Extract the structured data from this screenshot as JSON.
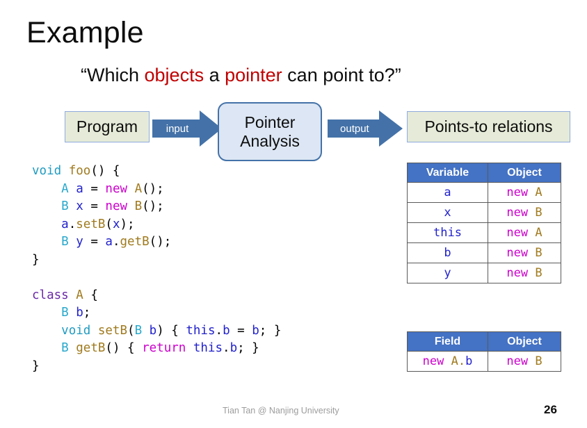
{
  "slide": {
    "title": "Example",
    "subtitle": {
      "part1": "“Which ",
      "hl1": "objects",
      "part2": " a ",
      "hl2": "pointer",
      "part3": " can point to?”"
    }
  },
  "diagram": {
    "program_label": "Program",
    "input_arrow_label": "input",
    "analysis_label_line1": "Pointer",
    "analysis_label_line2": "Analysis",
    "output_arrow_label": "output",
    "points_to_label": "Points-to relations",
    "arrow_color": "#4472A8",
    "box_fill": "#E5EBD8",
    "box_border": "#8FAADC",
    "analysis_fill": "#DCE6F4",
    "analysis_border": "#4472A8"
  },
  "code": {
    "lines": [
      [
        {
          "t": "void",
          "c": "t-kw"
        },
        {
          "t": " ",
          "c": "t-plain"
        },
        {
          "t": "foo",
          "c": "t-fn"
        },
        {
          "t": "() {",
          "c": "t-plain"
        }
      ],
      [
        {
          "t": "    ",
          "c": "t-plain"
        },
        {
          "t": "A",
          "c": "t-type"
        },
        {
          "t": " ",
          "c": "t-plain"
        },
        {
          "t": "a",
          "c": "t-var"
        },
        {
          "t": " = ",
          "c": "t-plain"
        },
        {
          "t": "new",
          "c": "t-new"
        },
        {
          "t": " ",
          "c": "t-plain"
        },
        {
          "t": "A",
          "c": "t-fn"
        },
        {
          "t": "();",
          "c": "t-plain"
        }
      ],
      [
        {
          "t": "    ",
          "c": "t-plain"
        },
        {
          "t": "B",
          "c": "t-type"
        },
        {
          "t": " ",
          "c": "t-plain"
        },
        {
          "t": "x",
          "c": "t-var"
        },
        {
          "t": " = ",
          "c": "t-plain"
        },
        {
          "t": "new",
          "c": "t-new"
        },
        {
          "t": " ",
          "c": "t-plain"
        },
        {
          "t": "B",
          "c": "t-fn"
        },
        {
          "t": "();",
          "c": "t-plain"
        }
      ],
      [
        {
          "t": "    ",
          "c": "t-plain"
        },
        {
          "t": "a",
          "c": "t-var"
        },
        {
          "t": ".",
          "c": "t-plain"
        },
        {
          "t": "setB",
          "c": "t-fn"
        },
        {
          "t": "(",
          "c": "t-plain"
        },
        {
          "t": "x",
          "c": "t-var"
        },
        {
          "t": ");",
          "c": "t-plain"
        }
      ],
      [
        {
          "t": "    ",
          "c": "t-plain"
        },
        {
          "t": "B",
          "c": "t-type"
        },
        {
          "t": " ",
          "c": "t-plain"
        },
        {
          "t": "y",
          "c": "t-var"
        },
        {
          "t": " = ",
          "c": "t-plain"
        },
        {
          "t": "a",
          "c": "t-var"
        },
        {
          "t": ".",
          "c": "t-plain"
        },
        {
          "t": "getB",
          "c": "t-fn"
        },
        {
          "t": "();",
          "c": "t-plain"
        }
      ],
      [
        {
          "t": "}",
          "c": "t-plain"
        }
      ],
      [
        {
          "t": "",
          "c": "t-plain"
        }
      ],
      [
        {
          "t": "class",
          "c": "t-class"
        },
        {
          "t": " ",
          "c": "t-plain"
        },
        {
          "t": "A",
          "c": "t-fn"
        },
        {
          "t": " {",
          "c": "t-plain"
        }
      ],
      [
        {
          "t": "    ",
          "c": "t-plain"
        },
        {
          "t": "B",
          "c": "t-type"
        },
        {
          "t": " ",
          "c": "t-plain"
        },
        {
          "t": "b",
          "c": "t-var"
        },
        {
          "t": ";",
          "c": "t-plain"
        }
      ],
      [
        {
          "t": "    ",
          "c": "t-plain"
        },
        {
          "t": "void",
          "c": "t-kw"
        },
        {
          "t": " ",
          "c": "t-plain"
        },
        {
          "t": "setB",
          "c": "t-fn"
        },
        {
          "t": "(",
          "c": "t-plain"
        },
        {
          "t": "B",
          "c": "t-type"
        },
        {
          "t": " ",
          "c": "t-plain"
        },
        {
          "t": "b",
          "c": "t-var"
        },
        {
          "t": ") { ",
          "c": "t-plain"
        },
        {
          "t": "this",
          "c": "t-var"
        },
        {
          "t": ".",
          "c": "t-plain"
        },
        {
          "t": "b",
          "c": "t-var"
        },
        {
          "t": " = ",
          "c": "t-plain"
        },
        {
          "t": "b",
          "c": "t-var"
        },
        {
          "t": "; }",
          "c": "t-plain"
        }
      ],
      [
        {
          "t": "    ",
          "c": "t-plain"
        },
        {
          "t": "B",
          "c": "t-type"
        },
        {
          "t": " ",
          "c": "t-plain"
        },
        {
          "t": "getB",
          "c": "t-fn"
        },
        {
          "t": "() { ",
          "c": "t-plain"
        },
        {
          "t": "return",
          "c": "t-new"
        },
        {
          "t": " ",
          "c": "t-plain"
        },
        {
          "t": "this",
          "c": "t-var"
        },
        {
          "t": ".",
          "c": "t-plain"
        },
        {
          "t": "b",
          "c": "t-var"
        },
        {
          "t": "; }",
          "c": "t-plain"
        }
      ],
      [
        {
          "t": "}",
          "c": "t-plain"
        }
      ]
    ]
  },
  "points_to_table": {
    "headers": [
      "Variable",
      "Object"
    ],
    "rows": [
      {
        "var": [
          {
            "t": "a",
            "c": "t-var"
          }
        ],
        "obj": [
          {
            "t": "new",
            "c": "t-new"
          },
          {
            "t": " ",
            "c": "t-plain"
          },
          {
            "t": "A",
            "c": "t-fn"
          }
        ]
      },
      {
        "var": [
          {
            "t": "x",
            "c": "t-var"
          }
        ],
        "obj": [
          {
            "t": "new",
            "c": "t-new"
          },
          {
            "t": " ",
            "c": "t-plain"
          },
          {
            "t": "B",
            "c": "t-fn"
          }
        ]
      },
      {
        "var": [
          {
            "t": "this",
            "c": "t-var"
          }
        ],
        "obj": [
          {
            "t": "new",
            "c": "t-new"
          },
          {
            "t": " ",
            "c": "t-plain"
          },
          {
            "t": "A",
            "c": "t-fn"
          }
        ]
      },
      {
        "var": [
          {
            "t": "b",
            "c": "t-var"
          }
        ],
        "obj": [
          {
            "t": "new",
            "c": "t-new"
          },
          {
            "t": " ",
            "c": "t-plain"
          },
          {
            "t": "B",
            "c": "t-fn"
          }
        ]
      },
      {
        "var": [
          {
            "t": "y",
            "c": "t-var"
          }
        ],
        "obj": [
          {
            "t": "new",
            "c": "t-new"
          },
          {
            "t": " ",
            "c": "t-plain"
          },
          {
            "t": "B",
            "c": "t-fn"
          }
        ]
      }
    ]
  },
  "field_table": {
    "headers": [
      "Field",
      "Object"
    ],
    "rows": [
      {
        "var": [
          {
            "t": "new",
            "c": "t-new"
          },
          {
            "t": " ",
            "c": "t-plain"
          },
          {
            "t": "A.",
            "c": "t-fn"
          },
          {
            "t": "b",
            "c": "t-var"
          }
        ],
        "obj": [
          {
            "t": "new",
            "c": "t-new"
          },
          {
            "t": " ",
            "c": "t-plain"
          },
          {
            "t": "B",
            "c": "t-fn"
          }
        ]
      }
    ]
  },
  "footer": {
    "credit": "Tian Tan @ Nanjing University",
    "page_number": "26"
  }
}
